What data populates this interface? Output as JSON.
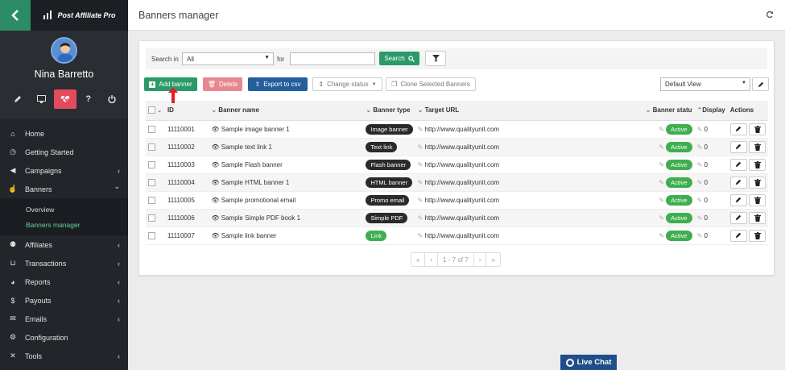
{
  "brand": {
    "name": "Post Affiliate Pro",
    "accent": "#2b8c67",
    "sidebar_bg": "#22262b"
  },
  "user": {
    "name": "Nina Barretto"
  },
  "profile_icons": [
    "pencil-icon",
    "monitor-icon",
    "heartbeat-icon",
    "question-icon",
    "power-icon"
  ],
  "nav": [
    {
      "label": "Home",
      "icon": "home-icon",
      "chev": ""
    },
    {
      "label": "Getting Started",
      "icon": "clock-icon",
      "chev": ""
    },
    {
      "label": "Campaigns",
      "icon": "megaphone-icon",
      "chev": "‹"
    },
    {
      "label": "Banners",
      "icon": "pointer-icon",
      "chev": "⌄"
    }
  ],
  "subnav": [
    {
      "label": "Overview"
    },
    {
      "label": "Banners manager"
    }
  ],
  "nav2": [
    {
      "label": "Affiliates",
      "icon": "users-icon",
      "chev": "‹"
    },
    {
      "label": "Transactions",
      "icon": "basket-icon",
      "chev": "‹"
    },
    {
      "label": "Reports",
      "icon": "pie-icon",
      "chev": "‹"
    },
    {
      "label": "Payouts",
      "icon": "moneybag-icon",
      "chev": "‹"
    },
    {
      "label": "Emails",
      "icon": "mail-icon",
      "chev": "‹"
    },
    {
      "label": "Configuration",
      "icon": "gear-icon",
      "chev": ""
    },
    {
      "label": "Tools",
      "icon": "tools-icon",
      "chev": "‹"
    }
  ],
  "page": {
    "title": "Banners manager"
  },
  "search": {
    "search_in_label": "Search in",
    "scope": "All",
    "for_label": "for",
    "query": "",
    "button": "Search"
  },
  "toolbar": {
    "add": "Add banner",
    "delete": "Delete",
    "export": "Export to csv",
    "change_status": "Change status",
    "clone": "Clone Selected Banners",
    "view": "Default View"
  },
  "table": {
    "columns": {
      "id": "ID",
      "name": "Banner name",
      "type": "Banner type",
      "url": "Target URL",
      "status": "Banner statu",
      "displays": "Display",
      "actions": "Actions"
    },
    "rows": [
      {
        "id": "11110001",
        "name": "Sample image banner 1",
        "type": "Image banner",
        "url": "http://www.qualityunit.com",
        "status": "Active",
        "displays": "0"
      },
      {
        "id": "11110002",
        "name": "Sample text link 1",
        "type": "Text link",
        "url": "http://www.qualityunit.com",
        "status": "Active",
        "displays": "0"
      },
      {
        "id": "11110003",
        "name": "Sample Flash banner",
        "type": "Flash banner",
        "url": "http://www.qualityunit.com",
        "status": "Active",
        "displays": "0"
      },
      {
        "id": "11110004",
        "name": "Sample HTML banner 1",
        "type": "HTML banner",
        "url": "http://www.qualityunit.com",
        "status": "Active",
        "displays": "0"
      },
      {
        "id": "11110005",
        "name": "Sample promotional email",
        "type": "Promo email",
        "url": "http://www.qualityunit.com",
        "status": "Active",
        "displays": "0"
      },
      {
        "id": "11110006",
        "name": "Sample Simple PDF book 1",
        "type": "Simple PDF",
        "url": "http://www.qualityunit.com",
        "status": "Active",
        "displays": "0"
      },
      {
        "id": "11110007",
        "name": "Sample link banner",
        "type": "Link",
        "url": "http://www.qualityunit.com",
        "status": "Active",
        "displays": "0"
      }
    ]
  },
  "pager": {
    "first": "«",
    "prev": "‹",
    "info": "1 - 7 of 7",
    "next": "›",
    "last": "»"
  },
  "livechat": {
    "label": "Live Chat"
  }
}
